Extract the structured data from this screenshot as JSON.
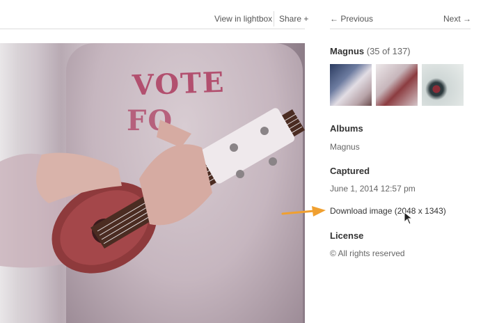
{
  "toolbar": {
    "lightbox_label": "View in lightbox",
    "share_label": "Share +"
  },
  "nav": {
    "previous_label": "← Previous",
    "next_label": "Next →"
  },
  "album": {
    "name": "Magnus",
    "position": "(35 of 137)"
  },
  "photo_text": {
    "line1": "VOTE",
    "line2": "FO"
  },
  "sections": {
    "albums_heading": "Albums",
    "albums_value": "Magnus",
    "captured_heading": "Captured",
    "captured_value": "June 1, 2014 12:57 pm",
    "download_label": "Download image (2048 x 1343)",
    "license_heading": "License",
    "license_value": "© All rights reserved"
  },
  "colors": {
    "annotation_arrow": "#f0a030",
    "shirt_print": "#b2506f"
  },
  "icons": [
    "arrow-annotation-icon",
    "mouse-cursor-icon"
  ]
}
